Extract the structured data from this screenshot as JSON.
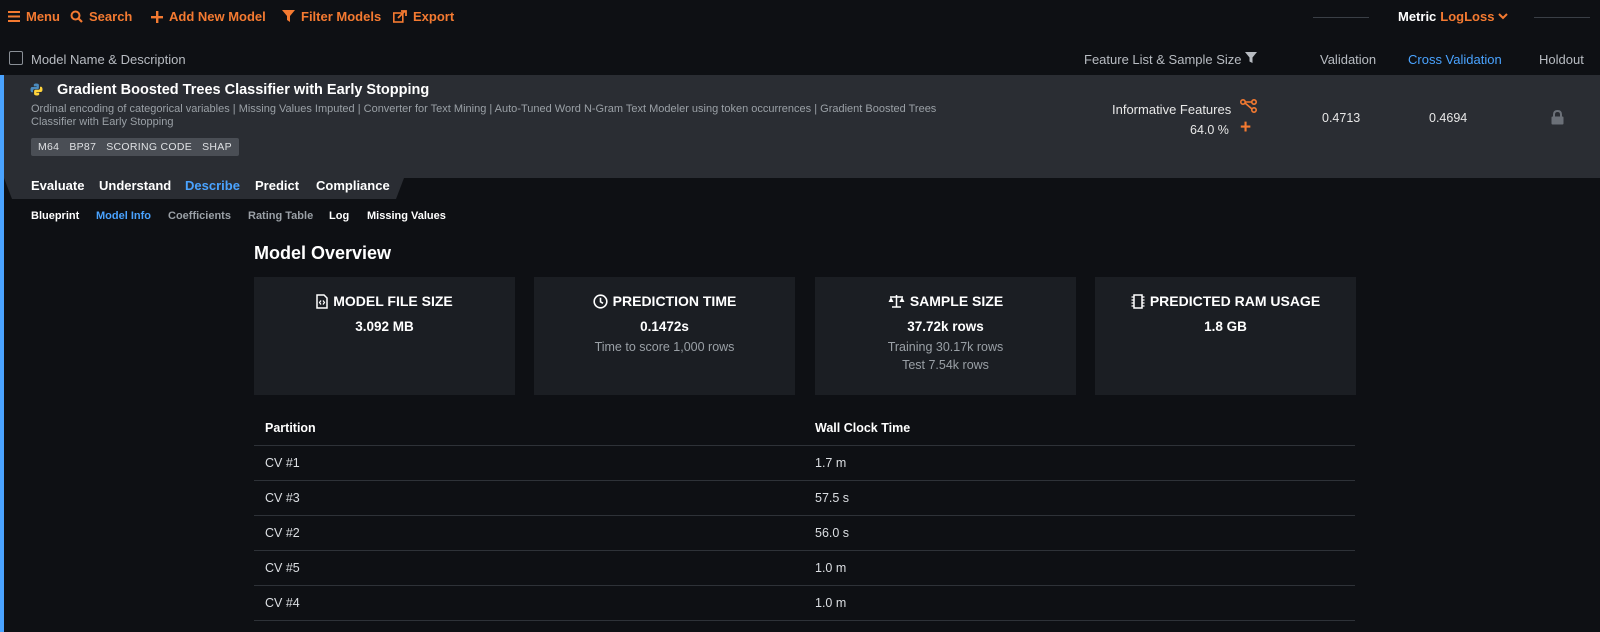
{
  "toolbar": {
    "menu": "Menu",
    "search": "Search",
    "add_model": "Add New Model",
    "filter": "Filter Models",
    "export": "Export",
    "metric_label": "Metric",
    "metric_value": "LogLoss"
  },
  "header": {
    "model_name": "Model Name & Description",
    "feature_list": "Feature List & Sample Size",
    "validation": "Validation",
    "cross_validation": "Cross Validation",
    "holdout": "Holdout"
  },
  "model": {
    "title": "Gradient Boosted Trees Classifier with Early Stopping",
    "description": "Ordinal encoding of categorical variables | Missing Values Imputed | Converter for Text Mining | Auto-Tuned Word N-Gram Text Modeler using token occurrences | Gradient Boosted Trees Classifier with Early Stopping",
    "badges": [
      "M64",
      "BP87",
      "SCORING CODE",
      "SHAP"
    ],
    "feature_list": "Informative Features",
    "sample_pct": "64.0 %",
    "validation": "0.4713",
    "cross_validation": "0.4694"
  },
  "tabs": [
    "Evaluate",
    "Understand",
    "Describe",
    "Predict",
    "Compliance"
  ],
  "active_tab": "Describe",
  "subtabs": [
    "Blueprint",
    "Model Info",
    "Coefficients",
    "Rating Table",
    "Log",
    "Missing Values"
  ],
  "active_subtab": "Model Info",
  "overview": {
    "title": "Model Overview",
    "cards": [
      {
        "title": "MODEL FILE SIZE",
        "value": "3.092 MB",
        "sub1": "",
        "sub2": "",
        "icon": "file-code-icon"
      },
      {
        "title": "PREDICTION TIME",
        "value": "0.1472s",
        "sub1": "Time to score 1,000 rows",
        "sub2": "",
        "icon": "clock-icon"
      },
      {
        "title": "SAMPLE SIZE",
        "value": "37.72k rows",
        "sub1": "Training 30.17k rows",
        "sub2": "Test 7.54k rows",
        "icon": "balance-scale-icon"
      },
      {
        "title": "PREDICTED RAM USAGE",
        "value": "1.8 GB",
        "sub1": "",
        "sub2": "",
        "icon": "memory-chip-icon"
      }
    ]
  },
  "timing_table": {
    "headers": [
      "Partition",
      "Wall Clock Time"
    ],
    "rows": [
      [
        "CV #1",
        "1.7 m"
      ],
      [
        "CV #3",
        "57.5 s"
      ],
      [
        "CV #2",
        "56.0 s"
      ],
      [
        "CV #5",
        "1.0 m"
      ],
      [
        "CV #4",
        "1.0 m"
      ]
    ]
  },
  "colors": {
    "accent_orange": "#f47a31",
    "accent_blue": "#4aa3ff",
    "background": "#0e1014",
    "row_bg": "#2a2d33"
  }
}
